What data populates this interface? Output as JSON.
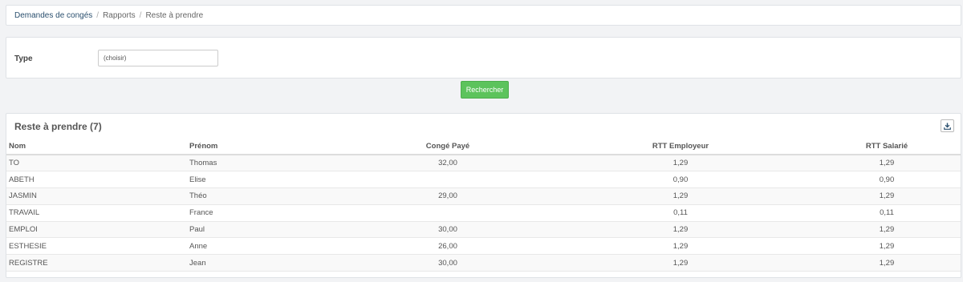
{
  "breadcrumb": {
    "items": [
      "Demandes de congés",
      "Rapports",
      "Reste à prendre"
    ],
    "separator": "/"
  },
  "filter": {
    "type_label": "Type",
    "type_select_value": "(choisir)"
  },
  "search_button": "Rechercher",
  "results": {
    "title": "Reste à prendre (7)",
    "download_icon": "download-icon",
    "columns": [
      "Nom",
      "Prénom",
      "Congé Payé",
      "RTT Employeur",
      "RTT Salarié"
    ],
    "rows": [
      [
        "TO",
        "Thomas",
        "32,00",
        "1,29",
        "1,29"
      ],
      [
        "ABETH",
        "Elise",
        "",
        "0,90",
        "0,90"
      ],
      [
        "JASMIN",
        "Théo",
        "29,00",
        "1,29",
        "1,29"
      ],
      [
        "TRAVAIL",
        "France",
        "",
        "0,11",
        "0,11"
      ],
      [
        "EMPLOI",
        "Paul",
        "30,00",
        "1,29",
        "1,29"
      ],
      [
        "ESTHESIE",
        "Anne",
        "26,00",
        "1,29",
        "1,29"
      ],
      [
        "REGISTRE",
        "Jean",
        "30,00",
        "1,29",
        "1,29"
      ]
    ]
  },
  "colors": {
    "button_green": "#5cc35c",
    "link_blue": "#2a4f6e"
  }
}
